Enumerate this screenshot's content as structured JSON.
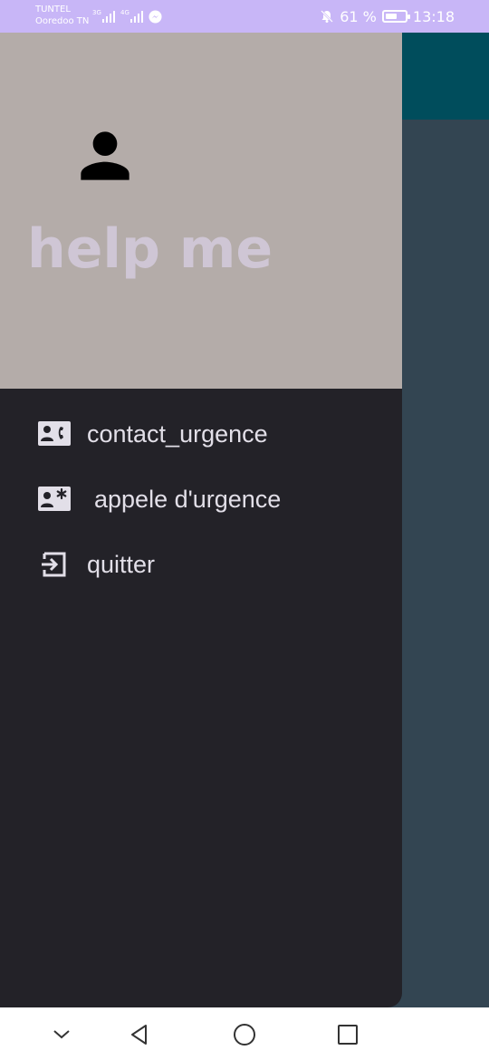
{
  "status_bar": {
    "carrier_line1": "TUNTEL",
    "carrier_line2": "Ooredoo TN",
    "signal1_type": "3G",
    "signal2_type": "4G",
    "battery_text": "61 %",
    "battery_level": 0.61,
    "time": "13:18"
  },
  "drawer": {
    "header_title": "help me",
    "menu_items": [
      {
        "label": "contact_urgence",
        "icon": "contact-phone-icon"
      },
      {
        "label": "appele d'urgence",
        "icon": "contact-emergency-icon"
      },
      {
        "label": "quitter",
        "icon": "exit-icon"
      }
    ]
  },
  "colors": {
    "status_bar_bg": "#c8b6f7",
    "toolbar": "#004d5c",
    "scrim_bg": "#334552",
    "drawer_bg": "#232228",
    "header_bg": "#b4aca9",
    "header_text": "#cfc6d5"
  },
  "nav_bar": {
    "icons": [
      "chevron-down-icon",
      "back-icon",
      "home-icon",
      "recents-icon"
    ]
  }
}
